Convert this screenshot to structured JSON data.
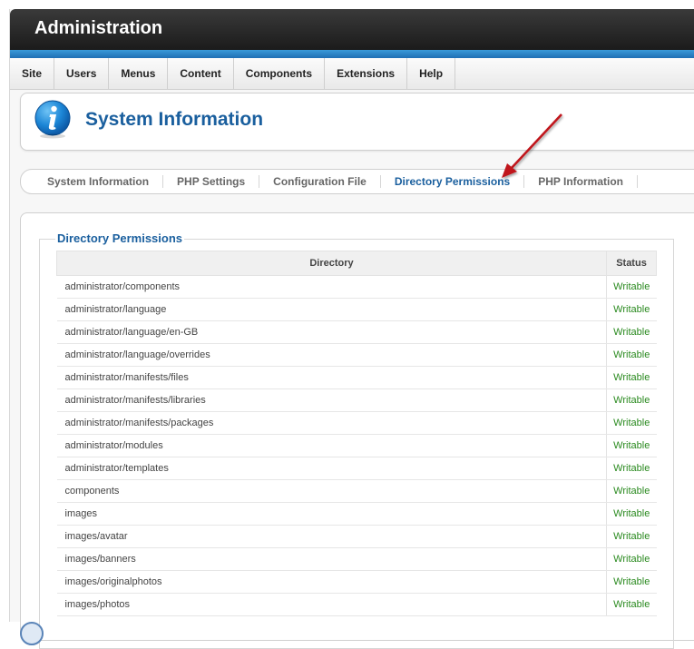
{
  "app": {
    "title": "Administration"
  },
  "menu": [
    "Site",
    "Users",
    "Menus",
    "Content",
    "Components",
    "Extensions",
    "Help"
  ],
  "page": {
    "title": "System Information"
  },
  "tabs": [
    "System Information",
    "PHP Settings",
    "Configuration File",
    "Directory Permissions",
    "PHP Information"
  ],
  "active_tab": "Directory Permissions",
  "section": {
    "legend": "Directory Permissions",
    "columns": [
      "Directory",
      "Status"
    ],
    "rows": [
      [
        "administrator/components",
        "Writable"
      ],
      [
        "administrator/language",
        "Writable"
      ],
      [
        "administrator/language/en-GB",
        "Writable"
      ],
      [
        "administrator/language/overrides",
        "Writable"
      ],
      [
        "administrator/manifests/files",
        "Writable"
      ],
      [
        "administrator/manifests/libraries",
        "Writable"
      ],
      [
        "administrator/manifests/packages",
        "Writable"
      ],
      [
        "administrator/modules",
        "Writable"
      ],
      [
        "administrator/templates",
        "Writable"
      ],
      [
        "components",
        "Writable"
      ],
      [
        "images",
        "Writable"
      ],
      [
        "images/avatar",
        "Writable"
      ],
      [
        "images/banners",
        "Writable"
      ],
      [
        "images/originalphotos",
        "Writable"
      ],
      [
        "images/photos",
        "Writable"
      ]
    ]
  },
  "colors": {
    "accent": "#1a5f9e",
    "writable": "#2a8a1f",
    "arrow": "#c0181e"
  },
  "icons": {
    "info": "info-icon",
    "annotation": "red-arrow-annotation"
  }
}
